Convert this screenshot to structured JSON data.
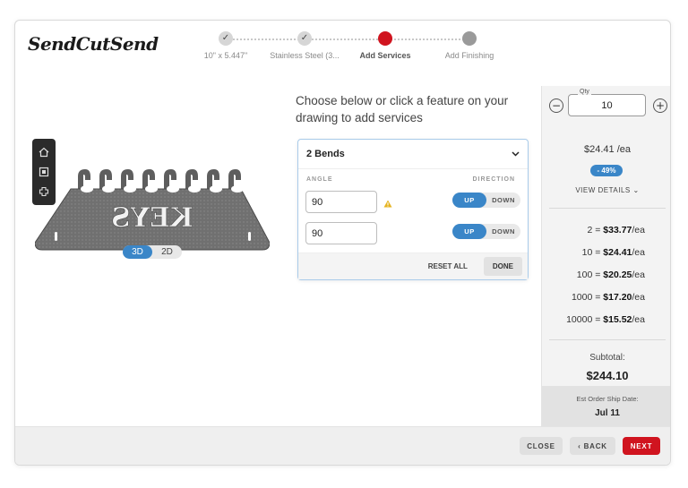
{
  "brand": {
    "logo_text": "SendCutSend"
  },
  "stepper": {
    "steps": [
      {
        "label": "10\" x 5.447\"",
        "state": "done"
      },
      {
        "label": "Stainless Steel (3...",
        "state": "done"
      },
      {
        "label": "Add Services",
        "state": "active"
      },
      {
        "label": "Add Finishing",
        "state": "todo"
      }
    ]
  },
  "viewer": {
    "tools": [
      "home-icon",
      "fit-view-icon",
      "pan-icon"
    ],
    "part_text": "KEYS",
    "view_modes": [
      "3D",
      "2D"
    ],
    "selected_view": "3D"
  },
  "services": {
    "prompt": "Choose below or click a feature on your drawing to add services",
    "section_title": "2 Bends",
    "col_angle": "ANGLE",
    "col_direction": "DIRECTION",
    "bends": [
      {
        "angle": "90",
        "warning": true,
        "dir_up": "UP",
        "dir_down": "DOWN",
        "selected": "UP"
      },
      {
        "angle": "90",
        "warning": false,
        "dir_up": "UP",
        "dir_down": "DOWN",
        "selected": "UP"
      }
    ],
    "reset_label": "RESET ALL",
    "done_label": "DONE"
  },
  "pricing": {
    "qty_label": "Qty",
    "qty_value": "10",
    "minus": "−",
    "plus": "+",
    "unit_price": "$24.41 /ea",
    "discount": "- 49%",
    "view_details": "VIEW DETAILS ⌄",
    "tiers": [
      {
        "qty": "2 = ",
        "price": "$33.77",
        "unit": "/ea"
      },
      {
        "qty": "10 = ",
        "price": "$24.41",
        "unit": "/ea"
      },
      {
        "qty": "100 = ",
        "price": "$20.25",
        "unit": "/ea"
      },
      {
        "qty": "1000 = ",
        "price": "$17.20",
        "unit": "/ea"
      },
      {
        "qty": "10000 = ",
        "price": "$15.52",
        "unit": "/ea"
      }
    ],
    "subtotal_label": "Subtotal:",
    "subtotal_value": "$244.10",
    "ship_label": "Est Order Ship Date:",
    "ship_date": "Jul 11"
  },
  "footer": {
    "close_label": "CLOSE",
    "back_label": "‹  BACK",
    "next_label": "NEXT"
  },
  "colors": {
    "accent_blue": "#3a86c8",
    "brand_red": "#d0141f",
    "part_steel": "#6f6f6f"
  }
}
